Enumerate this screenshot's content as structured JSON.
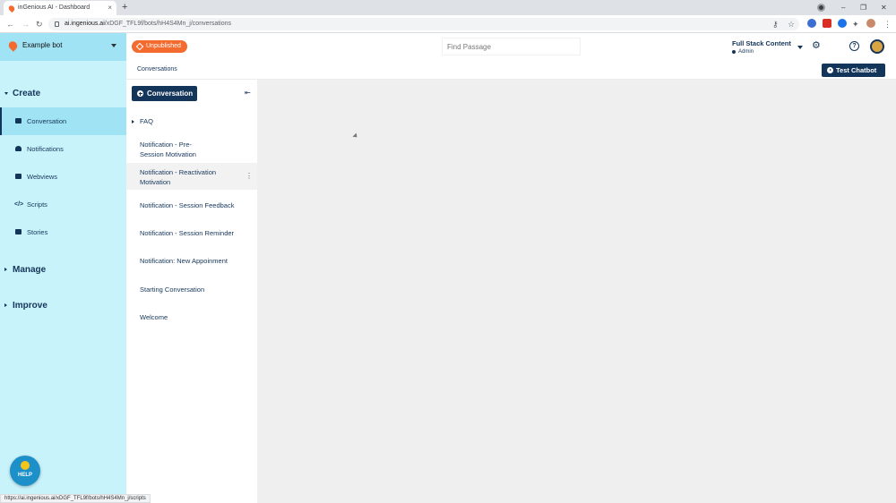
{
  "browser": {
    "tab_title": "inGenious AI - Dashboard",
    "tab_close": "×",
    "new_tab": "+",
    "win_minimize": "–",
    "win_restore": "❐",
    "win_close": "✕",
    "url_host": "ai.ingenious.ai",
    "url_path": "/xDGF_TFL9f/bots/hH4S4Mn_j/conversations",
    "status_url": "https://ai.ingenious.ai/xDGF_TFL9f/bots/hH4S4Mn_j/scripts"
  },
  "header": {
    "bot_name": "Example bot",
    "publish_status": "Unpublished",
    "search_placeholder": "Find Passage",
    "account_name": "Full Stack Content",
    "account_role": "Admin",
    "help_glyph": "?"
  },
  "subheader": {
    "breadcrumb": "Conversations",
    "test_button": "Test Chatbot"
  },
  "sidebar": {
    "create_label": "Create",
    "items": [
      {
        "label": "Conversation",
        "icon": "chat-icon"
      },
      {
        "label": "Notifications",
        "icon": "bell-icon"
      },
      {
        "label": "Webviews",
        "icon": "webview-icon"
      },
      {
        "label": "Scripts",
        "icon": "code-icon"
      },
      {
        "label": "Stories",
        "icon": "stories-icon"
      }
    ],
    "manage_label": "Manage",
    "improve_label": "Improve",
    "help_label": "HELP"
  },
  "conversations": {
    "add_button": "Conversation",
    "faq_label": "FAQ",
    "items": [
      "Notification - Pre-Session Motivation",
      "Notification - Reactivation Motivation",
      "Notification - Session Feedback",
      "Notification - Session Reminder",
      "Notification: New Appoinment",
      "Starting Conversation",
      "Welcome"
    ]
  },
  "colors": {
    "brand_navy": "#14355a",
    "accent_orange": "#f36b2e",
    "sidebar_bg": "#c9f3fb",
    "sidebar_active": "#9fe3f4"
  }
}
